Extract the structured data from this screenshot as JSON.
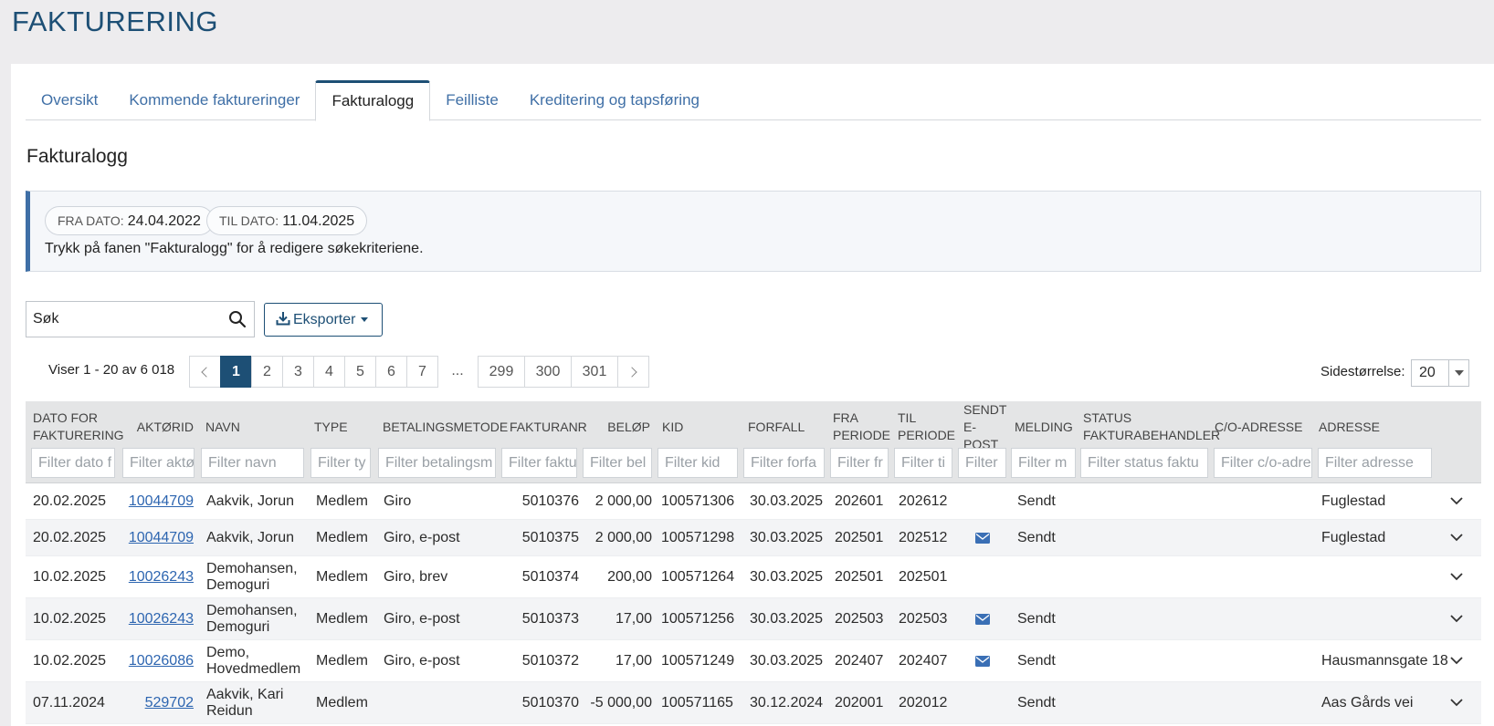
{
  "page_title": "FAKTURERING",
  "tabs": [
    "Oversikt",
    "Kommende faktureringer",
    "Fakturalogg",
    "Feilliste",
    "Kreditering og tapsføring"
  ],
  "active_tab": "Fakturalogg",
  "section_title": "Fakturalogg",
  "criteria": {
    "from_label": "FRA DATO:",
    "from_value": "24.04.2022",
    "to_label": "TIL DATO:",
    "to_value": "11.04.2025",
    "note": "Trykk på fanen \"Fakturalogg\" for å redigere søkekriteriene."
  },
  "search": {
    "value": "Søk"
  },
  "export_label": "Eksporter",
  "pagination": {
    "showing": "Viser 1 - 20 av 6 018",
    "pages": [
      "1",
      "2",
      "3",
      "4",
      "5",
      "6",
      "7"
    ],
    "dots": "...",
    "last_pages": [
      "299",
      "300",
      "301"
    ],
    "current": "1"
  },
  "page_size": {
    "label": "Sidestørrelse:",
    "value": "20"
  },
  "columns": [
    {
      "label": "DATO FOR FAKTURERING",
      "filter": "Filter dato f"
    },
    {
      "label": "AKTØRID",
      "filter": "Filter aktø"
    },
    {
      "label": "NAVN",
      "filter": "Filter navn"
    },
    {
      "label": "TYPE",
      "filter": "Filter ty"
    },
    {
      "label": "BETALINGSMETODE",
      "filter": "Filter betalingsm"
    },
    {
      "label": "FAKTURANR",
      "filter": "Filter faktu"
    },
    {
      "label": "BELØP",
      "filter": "Filter bel"
    },
    {
      "label": "KID",
      "filter": "Filter kid"
    },
    {
      "label": "FORFALL",
      "filter": "Filter forfa"
    },
    {
      "label": "FRA PERIODE",
      "filter": "Filter fr"
    },
    {
      "label": "TIL PERIODE",
      "filter": "Filter ti"
    },
    {
      "label": "SENDT E-POST",
      "filter": "Filter"
    },
    {
      "label": "MELDING",
      "filter": "Filter m"
    },
    {
      "label": "STATUS FAKTURABEHANDLER",
      "filter": "Filter status faktu"
    },
    {
      "label": "C/O-ADRESSE",
      "filter": "Filter c/o-adre"
    },
    {
      "label": "ADRESSE",
      "filter": "Filter adresse"
    }
  ],
  "rows": [
    {
      "dato": "20.02.2025",
      "aktorid": "10044709",
      "navn": "Aakvik, Jorun",
      "type": "Medlem",
      "betalingsmetode": "Giro",
      "fakturanr": "5010376",
      "belop": "2 000,00",
      "kid": "100571306",
      "forfall": "30.03.2025",
      "fra": "202601",
      "til": "202612",
      "epost": false,
      "melding": "Sendt",
      "status": "",
      "co": "",
      "adresse": "Fuglestad"
    },
    {
      "dato": "20.02.2025",
      "aktorid": "10044709",
      "navn": "Aakvik, Jorun",
      "type": "Medlem",
      "betalingsmetode": "Giro, e-post",
      "fakturanr": "5010375",
      "belop": "2 000,00",
      "kid": "100571298",
      "forfall": "30.03.2025",
      "fra": "202501",
      "til": "202512",
      "epost": true,
      "melding": "Sendt",
      "status": "",
      "co": "",
      "adresse": "Fuglestad"
    },
    {
      "dato": "10.02.2025",
      "aktorid": "10026243",
      "navn": "Demohansen, Demoguri",
      "type": "Medlem",
      "betalingsmetode": "Giro, brev",
      "fakturanr": "5010374",
      "belop": "200,00",
      "kid": "100571264",
      "forfall": "30.03.2025",
      "fra": "202501",
      "til": "202501",
      "epost": false,
      "melding": "",
      "status": "",
      "co": "",
      "adresse": ""
    },
    {
      "dato": "10.02.2025",
      "aktorid": "10026243",
      "navn": "Demohansen, Demoguri",
      "type": "Medlem",
      "betalingsmetode": "Giro, e-post",
      "fakturanr": "5010373",
      "belop": "17,00",
      "kid": "100571256",
      "forfall": "30.03.2025",
      "fra": "202503",
      "til": "202503",
      "epost": true,
      "melding": "Sendt",
      "status": "",
      "co": "",
      "adresse": ""
    },
    {
      "dato": "10.02.2025",
      "aktorid": "10026086",
      "navn": "Demo, Hovedmedlem",
      "type": "Medlem",
      "betalingsmetode": "Giro, e-post",
      "fakturanr": "5010372",
      "belop": "17,00",
      "kid": "100571249",
      "forfall": "30.03.2025",
      "fra": "202407",
      "til": "202407",
      "epost": true,
      "melding": "Sendt",
      "status": "",
      "co": "",
      "adresse": "Hausmannsgate 18"
    },
    {
      "dato": "07.11.2024",
      "aktorid": "529702",
      "navn": "Aakvik, Kari Reidun",
      "type": "Medlem",
      "betalingsmetode": "",
      "fakturanr": "5010370",
      "belop": "-5 000,00",
      "kid": "100571165",
      "forfall": "30.12.2024",
      "fra": "202001",
      "til": "202012",
      "epost": false,
      "melding": "Sendt",
      "status": "",
      "co": "",
      "adresse": "Aas Gårds vei"
    }
  ],
  "colors": {
    "brand": "#1d4f75",
    "link": "#2d65b0",
    "mail_icon": "#3a6fb5"
  }
}
